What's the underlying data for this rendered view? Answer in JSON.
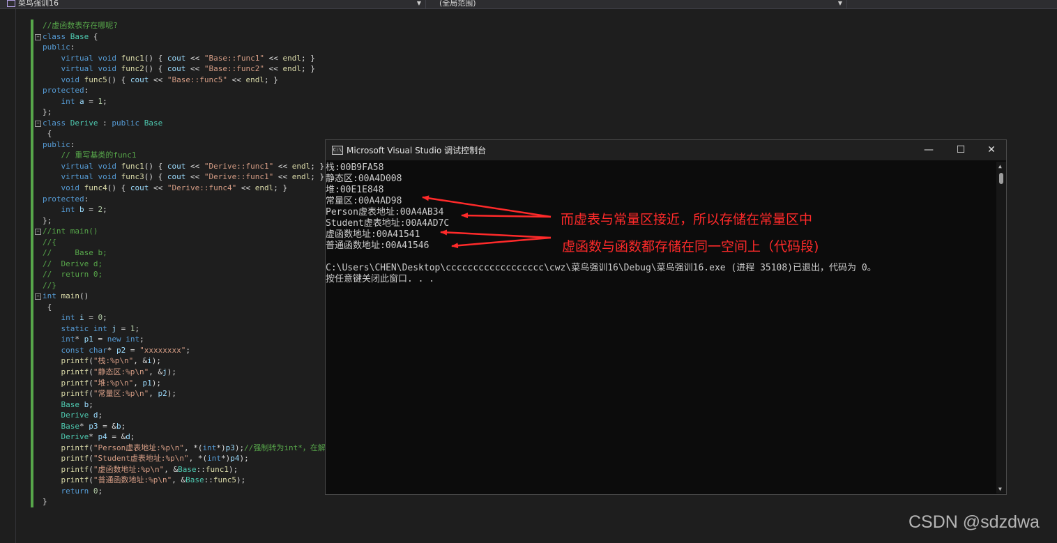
{
  "navbar": {
    "project": "菜鸟强训16",
    "scope": "(全局范围)"
  },
  "code_lines": [
    [
      [
        "//虚函数表存在哪呢?",
        "#57a64a"
      ]
    ],
    [
      [
        "class",
        "#569cd6"
      ],
      [
        " ",
        "#dcdcdc"
      ],
      [
        "Base",
        "#4ec9b0"
      ],
      [
        " {",
        "#dcdcdc"
      ]
    ],
    [
      [
        "public",
        "#569cd6"
      ],
      [
        ":",
        "#dcdcdc"
      ]
    ],
    [
      [
        "    ",
        "#dcdcdc"
      ],
      [
        "virtual",
        "#569cd6"
      ],
      [
        " ",
        "#dcdcdc"
      ],
      [
        "void",
        "#569cd6"
      ],
      [
        " ",
        "#dcdcdc"
      ],
      [
        "func1",
        "#dcdcaa"
      ],
      [
        "() { ",
        "#dcdcdc"
      ],
      [
        "cout",
        "#9cdcfe"
      ],
      [
        " << ",
        "#dcdcdc"
      ],
      [
        "\"Base::func1\"",
        "#d69d85"
      ],
      [
        " << ",
        "#dcdcdc"
      ],
      [
        "endl",
        "#dcdcaa"
      ],
      [
        "; }",
        "#dcdcdc"
      ]
    ],
    [
      [
        "    ",
        "#dcdcdc"
      ],
      [
        "virtual",
        "#569cd6"
      ],
      [
        " ",
        "#dcdcdc"
      ],
      [
        "void",
        "#569cd6"
      ],
      [
        " ",
        "#dcdcdc"
      ],
      [
        "func2",
        "#dcdcaa"
      ],
      [
        "() { ",
        "#dcdcdc"
      ],
      [
        "cout",
        "#9cdcfe"
      ],
      [
        " << ",
        "#dcdcdc"
      ],
      [
        "\"Base::func2\"",
        "#d69d85"
      ],
      [
        " << ",
        "#dcdcdc"
      ],
      [
        "endl",
        "#dcdcaa"
      ],
      [
        "; }",
        "#dcdcdc"
      ]
    ],
    [
      [
        "    ",
        "#dcdcdc"
      ],
      [
        "void",
        "#569cd6"
      ],
      [
        " ",
        "#dcdcdc"
      ],
      [
        "func5",
        "#dcdcaa"
      ],
      [
        "() { ",
        "#dcdcdc"
      ],
      [
        "cout",
        "#9cdcfe"
      ],
      [
        " << ",
        "#dcdcdc"
      ],
      [
        "\"Base::func5\"",
        "#d69d85"
      ],
      [
        " << ",
        "#dcdcdc"
      ],
      [
        "endl",
        "#dcdcaa"
      ],
      [
        "; }",
        "#dcdcdc"
      ]
    ],
    [
      [
        "protected",
        "#569cd6"
      ],
      [
        ":",
        "#dcdcdc"
      ]
    ],
    [
      [
        "    ",
        "#dcdcdc"
      ],
      [
        "int",
        "#569cd6"
      ],
      [
        " ",
        "#dcdcdc"
      ],
      [
        "a",
        "#9cdcfe"
      ],
      [
        " = ",
        "#dcdcdc"
      ],
      [
        "1",
        "#b5cea8"
      ],
      [
        ";",
        "#dcdcdc"
      ]
    ],
    [
      [
        "};",
        "#dcdcdc"
      ]
    ],
    [
      [
        "class",
        "#569cd6"
      ],
      [
        " ",
        "#dcdcdc"
      ],
      [
        "Derive",
        "#4ec9b0"
      ],
      [
        " : ",
        "#dcdcdc"
      ],
      [
        "public",
        "#569cd6"
      ],
      [
        " ",
        "#dcdcdc"
      ],
      [
        "Base",
        "#4ec9b0"
      ]
    ],
    [
      [
        " {",
        "#dcdcdc"
      ]
    ],
    [
      [
        "public",
        "#569cd6"
      ],
      [
        ":",
        "#dcdcdc"
      ]
    ],
    [
      [
        "    ",
        "#dcdcdc"
      ],
      [
        "// 重写基类的func1",
        "#57a64a"
      ]
    ],
    [
      [
        "    ",
        "#dcdcdc"
      ],
      [
        "virtual",
        "#569cd6"
      ],
      [
        " ",
        "#dcdcdc"
      ],
      [
        "void",
        "#569cd6"
      ],
      [
        " ",
        "#dcdcdc"
      ],
      [
        "func1",
        "#dcdcaa"
      ],
      [
        "() { ",
        "#dcdcdc"
      ],
      [
        "cout",
        "#9cdcfe"
      ],
      [
        " << ",
        "#dcdcdc"
      ],
      [
        "\"Derive::func1\"",
        "#d69d85"
      ],
      [
        " << ",
        "#dcdcdc"
      ],
      [
        "endl",
        "#dcdcaa"
      ],
      [
        "; }",
        "#dcdcdc"
      ]
    ],
    [
      [
        "    ",
        "#dcdcdc"
      ],
      [
        "virtual",
        "#569cd6"
      ],
      [
        " ",
        "#dcdcdc"
      ],
      [
        "void",
        "#569cd6"
      ],
      [
        " ",
        "#dcdcdc"
      ],
      [
        "func3",
        "#dcdcaa"
      ],
      [
        "() { ",
        "#dcdcdc"
      ],
      [
        "cout",
        "#9cdcfe"
      ],
      [
        " << ",
        "#dcdcdc"
      ],
      [
        "\"Derive::func1\"",
        "#d69d85"
      ],
      [
        " << ",
        "#dcdcdc"
      ],
      [
        "endl",
        "#dcdcaa"
      ],
      [
        "; }",
        "#dcdcdc"
      ]
    ],
    [
      [
        "    ",
        "#dcdcdc"
      ],
      [
        "void",
        "#569cd6"
      ],
      [
        " ",
        "#dcdcdc"
      ],
      [
        "func4",
        "#dcdcaa"
      ],
      [
        "() { ",
        "#dcdcdc"
      ],
      [
        "cout",
        "#9cdcfe"
      ],
      [
        " << ",
        "#dcdcdc"
      ],
      [
        "\"Derive::func4\"",
        "#d69d85"
      ],
      [
        " << ",
        "#dcdcdc"
      ],
      [
        "endl",
        "#dcdcaa"
      ],
      [
        "; }",
        "#dcdcdc"
      ]
    ],
    [
      [
        "protected",
        "#569cd6"
      ],
      [
        ":",
        "#dcdcdc"
      ]
    ],
    [
      [
        "    ",
        "#dcdcdc"
      ],
      [
        "int",
        "#569cd6"
      ],
      [
        " ",
        "#dcdcdc"
      ],
      [
        "b",
        "#9cdcfe"
      ],
      [
        " = ",
        "#dcdcdc"
      ],
      [
        "2",
        "#b5cea8"
      ],
      [
        ";",
        "#dcdcdc"
      ]
    ],
    [
      [
        "};",
        "#dcdcdc"
      ]
    ],
    [
      [
        "//int main()",
        "#57a64a"
      ]
    ],
    [
      [
        "//{",
        "#57a64a"
      ]
    ],
    [
      [
        "//     Base b;",
        "#57a64a"
      ]
    ],
    [
      [
        "//  Derive d;",
        "#57a64a"
      ]
    ],
    [
      [
        "//  return 0;",
        "#57a64a"
      ]
    ],
    [
      [
        "//}",
        "#57a64a"
      ]
    ],
    [
      [
        "int",
        "#569cd6"
      ],
      [
        " ",
        "#dcdcdc"
      ],
      [
        "main",
        "#dcdcaa"
      ],
      [
        "()",
        "#dcdcdc"
      ]
    ],
    [
      [
        " {",
        "#dcdcdc"
      ]
    ],
    [
      [
        "    ",
        "#dcdcdc"
      ],
      [
        "int",
        "#569cd6"
      ],
      [
        " ",
        "#dcdcdc"
      ],
      [
        "i",
        "#9cdcfe"
      ],
      [
        " = ",
        "#dcdcdc"
      ],
      [
        "0",
        "#b5cea8"
      ],
      [
        ";",
        "#dcdcdc"
      ]
    ],
    [
      [
        "    ",
        "#dcdcdc"
      ],
      [
        "static",
        "#569cd6"
      ],
      [
        " ",
        "#dcdcdc"
      ],
      [
        "int",
        "#569cd6"
      ],
      [
        " ",
        "#dcdcdc"
      ],
      [
        "j",
        "#9cdcfe"
      ],
      [
        " = ",
        "#dcdcdc"
      ],
      [
        "1",
        "#b5cea8"
      ],
      [
        ";",
        "#dcdcdc"
      ]
    ],
    [
      [
        "    ",
        "#dcdcdc"
      ],
      [
        "int",
        "#569cd6"
      ],
      [
        "* ",
        "#dcdcdc"
      ],
      [
        "p1",
        "#9cdcfe"
      ],
      [
        " = ",
        "#dcdcdc"
      ],
      [
        "new",
        "#569cd6"
      ],
      [
        " ",
        "#dcdcdc"
      ],
      [
        "int",
        "#569cd6"
      ],
      [
        ";",
        "#dcdcdc"
      ]
    ],
    [
      [
        "    ",
        "#dcdcdc"
      ],
      [
        "const",
        "#569cd6"
      ],
      [
        " ",
        "#dcdcdc"
      ],
      [
        "char",
        "#569cd6"
      ],
      [
        "* ",
        "#dcdcdc"
      ],
      [
        "p2",
        "#9cdcfe"
      ],
      [
        " = ",
        "#dcdcdc"
      ],
      [
        "\"xxxxxxxx\"",
        "#d69d85"
      ],
      [
        ";",
        "#dcdcdc"
      ]
    ],
    [
      [
        "    ",
        "#dcdcdc"
      ],
      [
        "printf",
        "#dcdcaa"
      ],
      [
        "(",
        "#dcdcdc"
      ],
      [
        "\"栈:%p\\n\"",
        "#d69d85"
      ],
      [
        ", &",
        "#dcdcdc"
      ],
      [
        "i",
        "#9cdcfe"
      ],
      [
        ");",
        "#dcdcdc"
      ]
    ],
    [
      [
        "    ",
        "#dcdcdc"
      ],
      [
        "printf",
        "#dcdcaa"
      ],
      [
        "(",
        "#dcdcdc"
      ],
      [
        "\"静态区:%p\\n\"",
        "#d69d85"
      ],
      [
        ", &",
        "#dcdcdc"
      ],
      [
        "j",
        "#9cdcfe"
      ],
      [
        ");",
        "#dcdcdc"
      ]
    ],
    [
      [
        "    ",
        "#dcdcdc"
      ],
      [
        "printf",
        "#dcdcaa"
      ],
      [
        "(",
        "#dcdcdc"
      ],
      [
        "\"堆:%p\\n\"",
        "#d69d85"
      ],
      [
        ", ",
        "#dcdcdc"
      ],
      [
        "p1",
        "#9cdcfe"
      ],
      [
        ");",
        "#dcdcdc"
      ]
    ],
    [
      [
        "    ",
        "#dcdcdc"
      ],
      [
        "printf",
        "#dcdcaa"
      ],
      [
        "(",
        "#dcdcdc"
      ],
      [
        "\"常量区:%p\\n\"",
        "#d69d85"
      ],
      [
        ", ",
        "#dcdcdc"
      ],
      [
        "p2",
        "#9cdcfe"
      ],
      [
        ");",
        "#dcdcdc"
      ]
    ],
    [
      [
        "    ",
        "#dcdcdc"
      ],
      [
        "Base",
        "#4ec9b0"
      ],
      [
        " ",
        "#dcdcdc"
      ],
      [
        "b",
        "#9cdcfe"
      ],
      [
        ";",
        "#dcdcdc"
      ]
    ],
    [
      [
        "    ",
        "#dcdcdc"
      ],
      [
        "Derive",
        "#4ec9b0"
      ],
      [
        " ",
        "#dcdcdc"
      ],
      [
        "d",
        "#9cdcfe"
      ],
      [
        ";",
        "#dcdcdc"
      ]
    ],
    [
      [
        "    ",
        "#dcdcdc"
      ],
      [
        "Base",
        "#4ec9b0"
      ],
      [
        "* ",
        "#dcdcdc"
      ],
      [
        "p3",
        "#9cdcfe"
      ],
      [
        " = &",
        "#dcdcdc"
      ],
      [
        "b",
        "#9cdcfe"
      ],
      [
        ";",
        "#dcdcdc"
      ]
    ],
    [
      [
        "    ",
        "#dcdcdc"
      ],
      [
        "Derive",
        "#4ec9b0"
      ],
      [
        "* ",
        "#dcdcdc"
      ],
      [
        "p4",
        "#9cdcfe"
      ],
      [
        " = &",
        "#dcdcdc"
      ],
      [
        "d",
        "#9cdcfe"
      ],
      [
        ";",
        "#dcdcdc"
      ]
    ],
    [
      [
        "    ",
        "#dcdcdc"
      ],
      [
        "printf",
        "#dcdcaa"
      ],
      [
        "(",
        "#dcdcdc"
      ],
      [
        "\"Person虚表地址:%p\\n\"",
        "#d69d85"
      ],
      [
        ", *(",
        "#dcdcdc"
      ],
      [
        "int",
        "#569cd6"
      ],
      [
        "*)",
        "#dcdcdc"
      ],
      [
        "p3",
        "#9cdcfe"
      ],
      [
        ");",
        "#dcdcdc"
      ],
      [
        "//强制转为int*，在解",
        "#57a64a"
      ]
    ],
    [
      [
        "    ",
        "#dcdcdc"
      ],
      [
        "printf",
        "#dcdcaa"
      ],
      [
        "(",
        "#dcdcdc"
      ],
      [
        "\"Student虚表地址:%p\\n\"",
        "#d69d85"
      ],
      [
        ", *(",
        "#dcdcdc"
      ],
      [
        "int",
        "#569cd6"
      ],
      [
        "*)",
        "#dcdcdc"
      ],
      [
        "p4",
        "#9cdcfe"
      ],
      [
        ");",
        "#dcdcdc"
      ]
    ],
    [
      [
        "    ",
        "#dcdcdc"
      ],
      [
        "printf",
        "#dcdcaa"
      ],
      [
        "(",
        "#dcdcdc"
      ],
      [
        "\"虚函数地址:%p\\n\"",
        "#d69d85"
      ],
      [
        ", &",
        "#dcdcdc"
      ],
      [
        "Base",
        "#4ec9b0"
      ],
      [
        "::",
        "#dcdcdc"
      ],
      [
        "func1",
        "#dcdcaa"
      ],
      [
        ");",
        "#dcdcdc"
      ]
    ],
    [
      [
        "    ",
        "#dcdcdc"
      ],
      [
        "printf",
        "#dcdcaa"
      ],
      [
        "(",
        "#dcdcdc"
      ],
      [
        "\"普通函数地址:%p\\n\"",
        "#d69d85"
      ],
      [
        ", &",
        "#dcdcdc"
      ],
      [
        "Base",
        "#4ec9b0"
      ],
      [
        "::",
        "#dcdcdc"
      ],
      [
        "func5",
        "#dcdcaa"
      ],
      [
        ");",
        "#dcdcdc"
      ]
    ],
    [
      [
        "    ",
        "#dcdcdc"
      ],
      [
        "return",
        "#569cd6"
      ],
      [
        " ",
        "#dcdcdc"
      ],
      [
        "0",
        "#b5cea8"
      ],
      [
        ";",
        "#dcdcdc"
      ]
    ],
    [
      [
        "}",
        "#dcdcdc"
      ]
    ]
  ],
  "console": {
    "title": "Microsoft Visual Studio 调试控制台",
    "icon_label": "C:\\",
    "minimize": "—",
    "maximize": "☐",
    "close": "✕",
    "lines": [
      "栈:00B9FA58",
      "静态区:00A4D008",
      "堆:00E1E848",
      "常量区:00A4AD98",
      "Person虚表地址:00A4AB34",
      "Student虚表地址:00A4AD7C",
      "虚函数地址:00A41541",
      "普通函数地址:00A41546",
      "",
      "C:\\Users\\CHEN\\Desktop\\cccccccccccccccccc\\cwz\\菜鸟强训16\\Debug\\菜鸟强训16.exe (进程 35108)已退出，代码为 0。",
      "按任意键关闭此窗口. . ."
    ]
  },
  "annotations": {
    "vtable_note": "而虚表与常量区接近，所以存储在常量区中",
    "function_note": "虚函数与函数都存储在同一空间上（代码段)",
    "color": "#ff2a2a"
  },
  "watermark": "CSDN @sdzdwa"
}
